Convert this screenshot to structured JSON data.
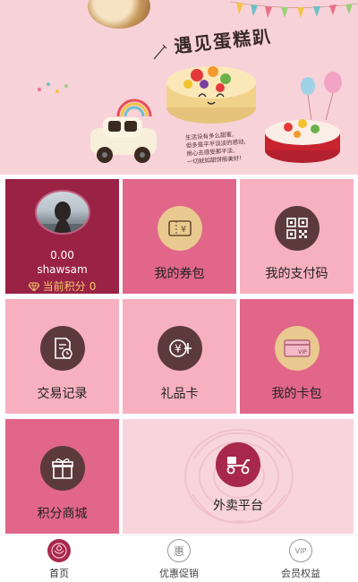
{
  "banner": {
    "title": "遇见蛋糕趴",
    "quote_lines": [
      "生活没有多么甜蜜,",
      "但多是平平淡淡的感动,",
      "用心去感受那平淡,",
      "一切就如甜饼般美好!"
    ]
  },
  "profile": {
    "balance": "0.00",
    "username": "shawsam",
    "points_label": "当前积分",
    "points_value": "0"
  },
  "tiles": {
    "coupon": "我的券包",
    "pay_code": "我的支付码",
    "trade": "交易记录",
    "gift_card": "礼品卡",
    "card_pack": "我的卡包",
    "points_mall": "积分商城",
    "takeout": "外卖平台"
  },
  "tabbar": {
    "home": "首页",
    "promo": "优惠促销",
    "member": "会员权益",
    "promo_icon_char": "惠",
    "member_icon_char": "VIP"
  },
  "colors": {
    "maroon": "#9a2245",
    "rose": "#e1668a",
    "pink": "#f7b0c0",
    "light_pink": "#f8d5dc",
    "icon_dark": "#5c3a3c",
    "icon_gold": "#e9c98f",
    "points_gold": "#f2c96a"
  },
  "icons": {
    "coupon": "coupon-ticket-icon",
    "pay_code": "qr-code-icon",
    "trade": "document-clock-icon",
    "gift_card": "yen-card-icon",
    "card_pack": "vip-card-icon",
    "points_mall": "gift-box-icon",
    "takeout": "delivery-scooter-icon",
    "home": "rose-icon",
    "promo": "hui-badge-icon",
    "member": "vip-badge-icon",
    "points": "diamond-icon"
  }
}
